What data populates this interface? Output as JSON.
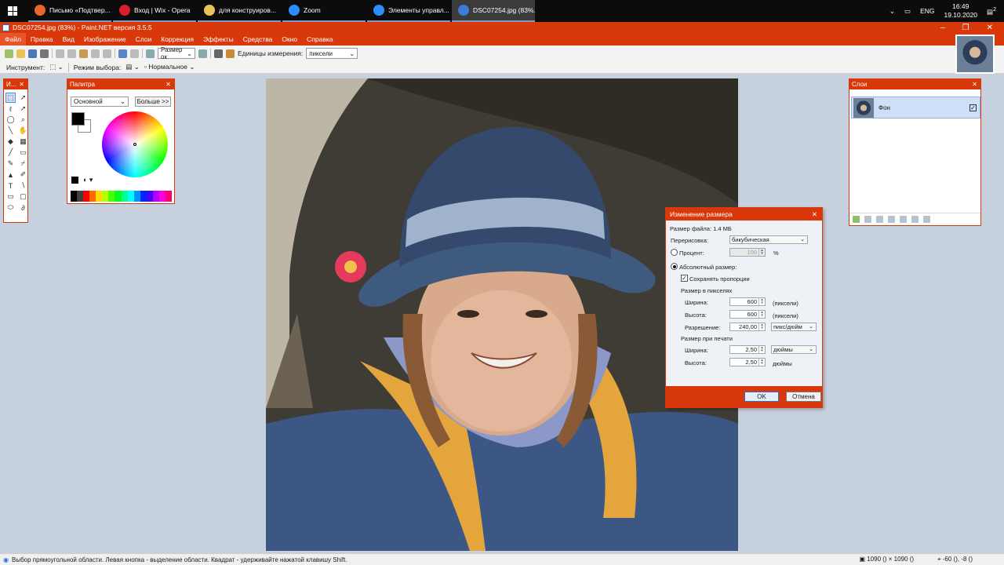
{
  "taskbar": {
    "tasks": [
      {
        "label": "Письмо «Подтвер...",
        "icon": "firefox-icon",
        "color": "#e8672a"
      },
      {
        "label": "Вход | Wix - Opera",
        "icon": "opera-icon",
        "color": "#d51f2d"
      },
      {
        "label": "для конструиров...",
        "icon": "folder-icon",
        "color": "#e8c35a"
      },
      {
        "label": "Zoom",
        "icon": "zoom-icon",
        "color": "#2d8cff"
      },
      {
        "label": "Элементы управл...",
        "icon": "zoom-icon",
        "color": "#2d8cff"
      },
      {
        "label": "DSC07254.jpg (83%...",
        "icon": "paintnet-icon",
        "color": "#3c7bd8"
      }
    ],
    "lang": "ENG",
    "time": "16:49",
    "date": "19.10.2020",
    "notif_count": "2"
  },
  "window": {
    "title": "DSC07254.jpg (83%) - Paint.NET версия 3.5.5"
  },
  "menu": [
    "Файл",
    "Правка",
    "Вид",
    "Изображение",
    "Слои",
    "Коррекция",
    "Эффекты",
    "Средства",
    "Окно",
    "Справка"
  ],
  "toolbar": {
    "zoom_value": "Размер ок",
    "units_label": "Единицы измерения:",
    "units_value": "пиксели",
    "tool_label": "Инструмент:",
    "selection_mode_label": "Режим выбора:",
    "blend_mode": "Нормальное"
  },
  "tools_window": {
    "title": "И..."
  },
  "palette": {
    "title": "Палитра",
    "mode": "Основной",
    "more_button": "Больше >>",
    "strip_colors": [
      "#000000",
      "#404040",
      "#ff0000",
      "#ff6a00",
      "#ffd800",
      "#b6ff00",
      "#4cff00",
      "#00ff21",
      "#00ff90",
      "#00ffff",
      "#0094ff",
      "#0026ff",
      "#4800ff",
      "#b200ff",
      "#ff00dc",
      "#ff006e"
    ]
  },
  "layers": {
    "title": "Слои",
    "items": [
      {
        "name": "Фон",
        "visible": true
      }
    ]
  },
  "resize_dialog": {
    "title": "Изменение размера",
    "file_size": "Размер файла: 1.4 МБ",
    "resampling_label": "Перерисовка:",
    "resampling_value": "бикубическая",
    "percent_label": "Процент:",
    "percent_value": "100",
    "percent_unit": "%",
    "absolute_label": "Абсолютный размер:",
    "keep_ratio_label": "Сохранять пропорции",
    "pixel_size_header": "Размер в пикселях",
    "width_label": "Ширина:",
    "width_value": "600",
    "width_unit": "(пиксели)",
    "height_label": "Высота:",
    "height_value": "600",
    "height_unit": "(пиксели)",
    "resolution_label": "Разрешение:",
    "resolution_value": "240,00",
    "resolution_unit": "пикс/дюйм",
    "print_size_header": "Размер при печати",
    "print_width_label": "Ширина:",
    "print_width_value": "2,50",
    "print_width_unit": "дюймы",
    "print_height_label": "Высота:",
    "print_height_value": "2,50",
    "print_height_unit": "дюймы",
    "ok_label": "OK",
    "cancel_label": "Отмена"
  },
  "status": {
    "hint": "Выбор прямоугольной области. Левая кнопка - выделение области. Квадрат - удерживайте нажатой клавишу Shift.",
    "image_size": "1090 () × 1090 ()",
    "cursor_pos": "-60 (), -8 ()"
  }
}
